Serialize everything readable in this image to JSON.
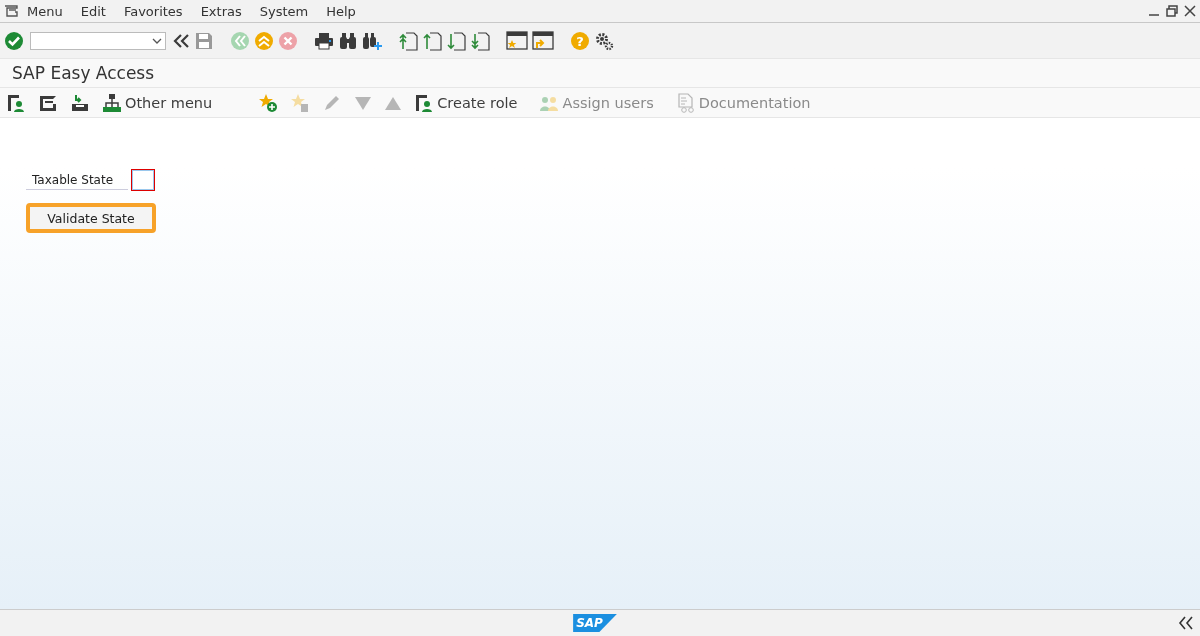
{
  "menu_bar": {
    "items": [
      "Menu",
      "Edit",
      "Favorites",
      "Extras",
      "System",
      "Help"
    ]
  },
  "system_toolbar": [
    {
      "kind": "enter",
      "disabled": false
    },
    {
      "kind": "command-field",
      "disabled": false
    },
    {
      "kind": "collapse",
      "disabled": false
    },
    {
      "kind": "save",
      "disabled": true
    },
    {
      "kind": "back",
      "disabled": true
    },
    {
      "kind": "exit",
      "disabled": false
    },
    {
      "kind": "cancel",
      "disabled": true
    },
    {
      "kind": "print",
      "disabled": false
    },
    {
      "kind": "find",
      "disabled": false
    },
    {
      "kind": "find-next",
      "disabled": false
    },
    {
      "kind": "first-page",
      "disabled": false
    },
    {
      "kind": "previous-page",
      "disabled": false
    },
    {
      "kind": "next-page",
      "disabled": false
    },
    {
      "kind": "last-page",
      "disabled": false
    },
    {
      "kind": "new-session",
      "disabled": false
    },
    {
      "kind": "shortcut",
      "disabled": false
    },
    {
      "kind": "help",
      "glyph": "?",
      "disabled": false
    },
    {
      "kind": "settings",
      "disabled": false
    }
  ],
  "title": "SAP Easy Access",
  "application_toolbar": [
    {
      "kind": "user-menu",
      "disabled": false
    },
    {
      "kind": "sap-menu",
      "disabled": false
    },
    {
      "kind": "business-workplace",
      "disabled": false
    },
    {
      "kind": "other-menu",
      "label": "Other menu",
      "disabled": false
    },
    {
      "kind": "add-favorite",
      "disabled": false
    },
    {
      "kind": "delete-favorite",
      "disabled": true
    },
    {
      "kind": "edit",
      "disabled": true
    },
    {
      "kind": "move-down",
      "disabled": true
    },
    {
      "kind": "move-up",
      "disabled": true
    },
    {
      "kind": "create-role",
      "label": "Create role",
      "disabled": false
    },
    {
      "kind": "assign-users",
      "label": "Assign users",
      "disabled": true
    },
    {
      "kind": "documentation",
      "label": "Documentation",
      "disabled": true
    }
  ],
  "form": {
    "field": {
      "label": "Taxable State",
      "focused": true
    },
    "button": {
      "label": "Validate State",
      "focused": true
    }
  },
  "status_bar": {
    "logo": "SAP"
  }
}
